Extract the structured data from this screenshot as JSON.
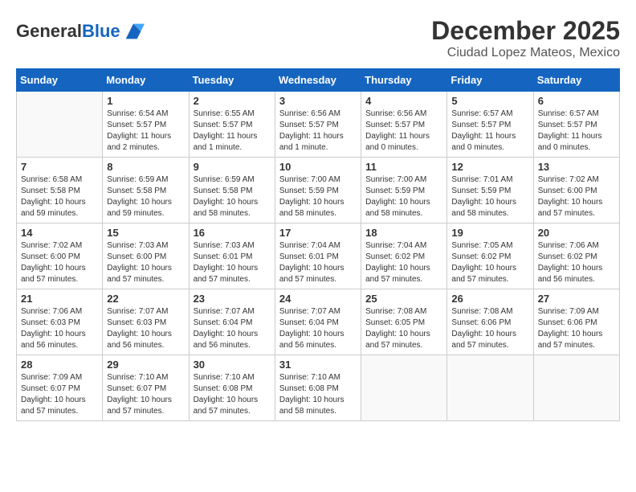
{
  "header": {
    "logo_general": "General",
    "logo_blue": "Blue",
    "month_title": "December 2025",
    "subtitle": "Ciudad Lopez Mateos, Mexico"
  },
  "days_of_week": [
    "Sunday",
    "Monday",
    "Tuesday",
    "Wednesday",
    "Thursday",
    "Friday",
    "Saturday"
  ],
  "weeks": [
    [
      {
        "day": "",
        "info": ""
      },
      {
        "day": "1",
        "info": "Sunrise: 6:54 AM\nSunset: 5:57 PM\nDaylight: 11 hours\nand 2 minutes."
      },
      {
        "day": "2",
        "info": "Sunrise: 6:55 AM\nSunset: 5:57 PM\nDaylight: 11 hours\nand 1 minute."
      },
      {
        "day": "3",
        "info": "Sunrise: 6:56 AM\nSunset: 5:57 PM\nDaylight: 11 hours\nand 1 minute."
      },
      {
        "day": "4",
        "info": "Sunrise: 6:56 AM\nSunset: 5:57 PM\nDaylight: 11 hours\nand 0 minutes."
      },
      {
        "day": "5",
        "info": "Sunrise: 6:57 AM\nSunset: 5:57 PM\nDaylight: 11 hours\nand 0 minutes."
      },
      {
        "day": "6",
        "info": "Sunrise: 6:57 AM\nSunset: 5:57 PM\nDaylight: 11 hours\nand 0 minutes."
      }
    ],
    [
      {
        "day": "7",
        "info": "Sunrise: 6:58 AM\nSunset: 5:58 PM\nDaylight: 10 hours\nand 59 minutes."
      },
      {
        "day": "8",
        "info": "Sunrise: 6:59 AM\nSunset: 5:58 PM\nDaylight: 10 hours\nand 59 minutes."
      },
      {
        "day": "9",
        "info": "Sunrise: 6:59 AM\nSunset: 5:58 PM\nDaylight: 10 hours\nand 58 minutes."
      },
      {
        "day": "10",
        "info": "Sunrise: 7:00 AM\nSunset: 5:59 PM\nDaylight: 10 hours\nand 58 minutes."
      },
      {
        "day": "11",
        "info": "Sunrise: 7:00 AM\nSunset: 5:59 PM\nDaylight: 10 hours\nand 58 minutes."
      },
      {
        "day": "12",
        "info": "Sunrise: 7:01 AM\nSunset: 5:59 PM\nDaylight: 10 hours\nand 58 minutes."
      },
      {
        "day": "13",
        "info": "Sunrise: 7:02 AM\nSunset: 6:00 PM\nDaylight: 10 hours\nand 57 minutes."
      }
    ],
    [
      {
        "day": "14",
        "info": "Sunrise: 7:02 AM\nSunset: 6:00 PM\nDaylight: 10 hours\nand 57 minutes."
      },
      {
        "day": "15",
        "info": "Sunrise: 7:03 AM\nSunset: 6:00 PM\nDaylight: 10 hours\nand 57 minutes."
      },
      {
        "day": "16",
        "info": "Sunrise: 7:03 AM\nSunset: 6:01 PM\nDaylight: 10 hours\nand 57 minutes."
      },
      {
        "day": "17",
        "info": "Sunrise: 7:04 AM\nSunset: 6:01 PM\nDaylight: 10 hours\nand 57 minutes."
      },
      {
        "day": "18",
        "info": "Sunrise: 7:04 AM\nSunset: 6:02 PM\nDaylight: 10 hours\nand 57 minutes."
      },
      {
        "day": "19",
        "info": "Sunrise: 7:05 AM\nSunset: 6:02 PM\nDaylight: 10 hours\nand 57 minutes."
      },
      {
        "day": "20",
        "info": "Sunrise: 7:06 AM\nSunset: 6:02 PM\nDaylight: 10 hours\nand 56 minutes."
      }
    ],
    [
      {
        "day": "21",
        "info": "Sunrise: 7:06 AM\nSunset: 6:03 PM\nDaylight: 10 hours\nand 56 minutes."
      },
      {
        "day": "22",
        "info": "Sunrise: 7:07 AM\nSunset: 6:03 PM\nDaylight: 10 hours\nand 56 minutes."
      },
      {
        "day": "23",
        "info": "Sunrise: 7:07 AM\nSunset: 6:04 PM\nDaylight: 10 hours\nand 56 minutes."
      },
      {
        "day": "24",
        "info": "Sunrise: 7:07 AM\nSunset: 6:04 PM\nDaylight: 10 hours\nand 56 minutes."
      },
      {
        "day": "25",
        "info": "Sunrise: 7:08 AM\nSunset: 6:05 PM\nDaylight: 10 hours\nand 57 minutes."
      },
      {
        "day": "26",
        "info": "Sunrise: 7:08 AM\nSunset: 6:06 PM\nDaylight: 10 hours\nand 57 minutes."
      },
      {
        "day": "27",
        "info": "Sunrise: 7:09 AM\nSunset: 6:06 PM\nDaylight: 10 hours\nand 57 minutes."
      }
    ],
    [
      {
        "day": "28",
        "info": "Sunrise: 7:09 AM\nSunset: 6:07 PM\nDaylight: 10 hours\nand 57 minutes."
      },
      {
        "day": "29",
        "info": "Sunrise: 7:10 AM\nSunset: 6:07 PM\nDaylight: 10 hours\nand 57 minutes."
      },
      {
        "day": "30",
        "info": "Sunrise: 7:10 AM\nSunset: 6:08 PM\nDaylight: 10 hours\nand 57 minutes."
      },
      {
        "day": "31",
        "info": "Sunrise: 7:10 AM\nSunset: 6:08 PM\nDaylight: 10 hours\nand 58 minutes."
      },
      {
        "day": "",
        "info": ""
      },
      {
        "day": "",
        "info": ""
      },
      {
        "day": "",
        "info": ""
      }
    ]
  ]
}
